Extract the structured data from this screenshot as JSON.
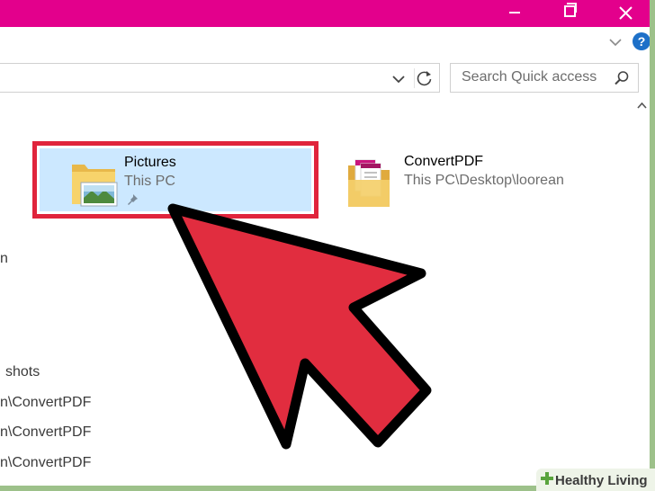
{
  "title_bar": {
    "color": "#e3008c",
    "buttons": [
      "minimize-icon",
      "maximize-icon",
      "close-icon"
    ]
  },
  "ribbon": {
    "expand_icon": "chevron-down-icon",
    "help_label": "?"
  },
  "address_bar": {
    "dropdown_icon": "chevron-down-icon",
    "refresh_icon": "refresh-icon"
  },
  "search": {
    "placeholder": "Search Quick access",
    "icon": "search-icon"
  },
  "quick_access": {
    "items": [
      {
        "name": "Pictures",
        "location": "This PC",
        "pinned": true,
        "selected": true,
        "icon": "pictures-folder-icon"
      },
      {
        "name": "ConvertPDF",
        "location": "This PC\\Desktop\\loorean",
        "pinned": false,
        "selected": false,
        "icon": "documents-folder-icon"
      }
    ]
  },
  "left_fragments": [
    "n"
  ],
  "recent_files": {
    "rows": [
      "shots",
      "n\\ConvertPDF",
      "n\\ConvertPDF",
      "n\\ConvertPDF"
    ]
  },
  "highlight_color": "#e0243c",
  "watermark": {
    "text": "Healthy Living"
  }
}
